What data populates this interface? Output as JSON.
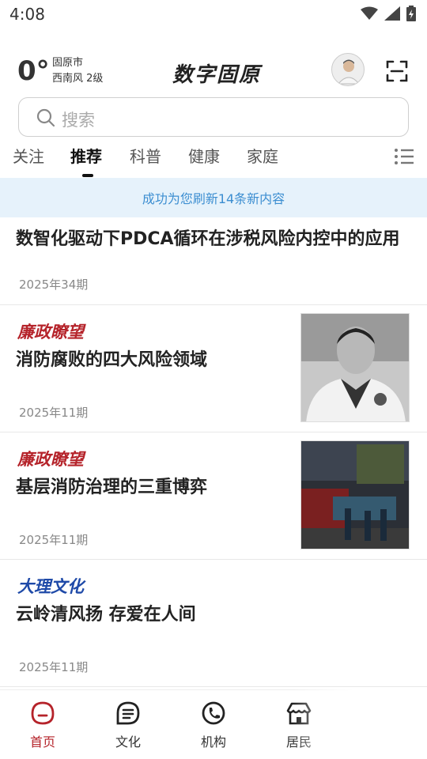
{
  "status_bar": {
    "time": "4:08"
  },
  "weather": {
    "temperature": "0°",
    "city": "固原市",
    "wind": "西南风 2级"
  },
  "app": {
    "logo_text": "数字固原"
  },
  "search": {
    "placeholder": "搜索"
  },
  "tabs": [
    {
      "label": "关注",
      "active": false
    },
    {
      "label": "推荐",
      "active": true
    },
    {
      "label": "科普",
      "active": false
    },
    {
      "label": "健康",
      "active": false
    },
    {
      "label": "家庭",
      "active": false
    }
  ],
  "refresh_banner": "成功为您刷新14条新内容",
  "articles": [
    {
      "tag": "",
      "title": "数智化驱动下PDCA循环在涉税风险内控中的应用",
      "date": "2025年34期",
      "has_thumb": false
    },
    {
      "tag": "廉政瞭望",
      "tag_color": "#b5232a",
      "title": "消防腐败的四大风险领域",
      "date": "2025年11期",
      "has_thumb": true,
      "thumb_icon": "officer-portrait"
    },
    {
      "tag": "廉政瞭望",
      "tag_color": "#b5232a",
      "title": "基层消防治理的三重博弈",
      "date": "2025年11期",
      "has_thumb": true,
      "thumb_icon": "fire-scene-photo"
    },
    {
      "tag": "大理文化",
      "tag_color": "#1f4aa8",
      "title": "云岭清风扬 存爱在人间",
      "date": "2025年11期",
      "has_thumb": false
    }
  ],
  "bottom_nav": [
    {
      "label": "首页",
      "icon": "home-icon",
      "active": true
    },
    {
      "label": "文化",
      "icon": "culture-icon",
      "active": false
    },
    {
      "label": "机构",
      "icon": "institution-icon",
      "active": false
    },
    {
      "label": "居民",
      "icon": "resident-icon",
      "active": false
    },
    {
      "label": "",
      "icon": "service-icon",
      "active": false
    }
  ],
  "colors": {
    "accent": "#b5232a",
    "banner_bg": "#e6f2fb",
    "banner_text": "#3c8ed1"
  }
}
